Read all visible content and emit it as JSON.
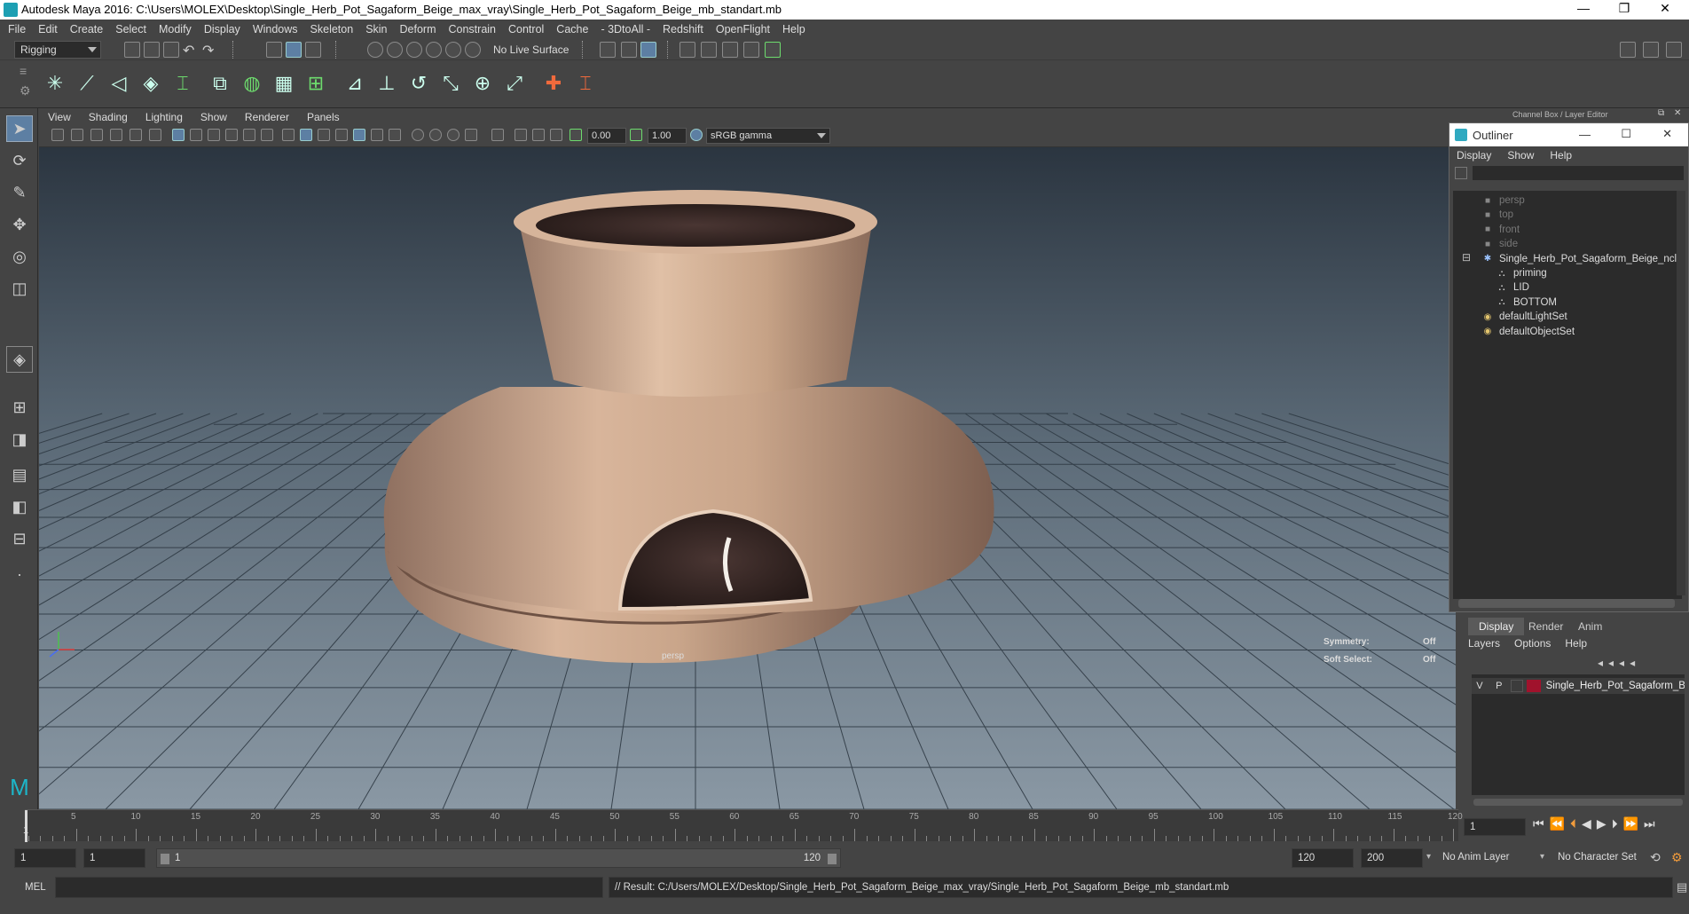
{
  "window": {
    "title": "Autodesk Maya 2016: C:\\Users\\MOLEX\\Desktop\\Single_Herb_Pot_Sagaform_Beige_max_vray\\Single_Herb_Pot_Sagaform_Beige_mb_standart.mb",
    "minimize": "—",
    "restore": "❐",
    "close": "✕"
  },
  "menubar": [
    "File",
    "Edit",
    "Create",
    "Select",
    "Modify",
    "Display",
    "Windows",
    "Skeleton",
    "Skin",
    "Deform",
    "Constrain",
    "Control",
    "Cache",
    "- 3DtoAll -",
    "Redshift",
    "OpenFlight",
    "Help"
  ],
  "statusline": {
    "mode": "Rigging",
    "live_surface": "No Live Surface"
  },
  "viewport": {
    "menu": [
      "View",
      "Shading",
      "Lighting",
      "Show",
      "Renderer",
      "Panels"
    ],
    "exposure": "0.00",
    "gamma": "1.00",
    "color_space": "sRGB gamma",
    "camera_label": "persp",
    "hud": {
      "symmetry_label": "Symmetry:",
      "symmetry_value": "Off",
      "soft_select_label": "Soft Select:",
      "soft_select_value": "Off"
    }
  },
  "channel_box": {
    "title": "Channel Box / Layer Editor"
  },
  "outliner": {
    "title": "Outliner",
    "menu": [
      "Display",
      "Show",
      "Help"
    ],
    "items": [
      {
        "label": "persp",
        "icon": "camera-icon",
        "dim": true
      },
      {
        "label": "top",
        "icon": "camera-icon",
        "dim": true
      },
      {
        "label": "front",
        "icon": "camera-icon",
        "dim": true
      },
      {
        "label": "side",
        "icon": "camera-icon",
        "dim": true
      },
      {
        "label": "Single_Herb_Pot_Sagaform_Beige_ncl",
        "icon": "group-icon",
        "dim": false
      },
      {
        "label": "priming",
        "icon": "mesh-icon",
        "dim": false
      },
      {
        "label": "LID",
        "icon": "mesh-icon",
        "dim": false
      },
      {
        "label": "BOTTOM",
        "icon": "mesh-icon",
        "dim": false
      },
      {
        "label": "defaultLightSet",
        "icon": "set-icon",
        "dim": false
      },
      {
        "label": "defaultObjectSet",
        "icon": "set-icon",
        "dim": false
      }
    ]
  },
  "layer_editor": {
    "tabs": [
      "Display",
      "Render",
      "Anim"
    ],
    "menu": [
      "Layers",
      "Options",
      "Help"
    ],
    "layer": {
      "v": "V",
      "p": "P",
      "name": "Single_Herb_Pot_Sagaform_B",
      "color": "#a0122c"
    }
  },
  "timeline": {
    "ticks": [
      "5",
      "10",
      "15",
      "20",
      "25",
      "30",
      "35",
      "40",
      "45",
      "50",
      "55",
      "60",
      "65",
      "70",
      "75",
      "80",
      "85",
      "90",
      "95",
      "100",
      "105",
      "110",
      "115",
      "120"
    ],
    "start_marker": "1",
    "current_frame": "1"
  },
  "range": {
    "start": "1",
    "playback_start": "1",
    "slider_start": "1",
    "slider_end": "120",
    "playback_end": "120",
    "end": "200",
    "anim_layer": "No Anim Layer",
    "character_set": "No Character Set"
  },
  "command": {
    "language": "MEL",
    "result": "// Result: C:/Users/MOLEX/Desktop/Single_Herb_Pot_Sagaform_Beige_max_vray/Single_Herb_Pot_Sagaform_Beige_mb_standart.mb"
  },
  "colors": {
    "pot": "#c9a58a",
    "soil": "#2e2120",
    "selected": "#5d7fa3"
  }
}
